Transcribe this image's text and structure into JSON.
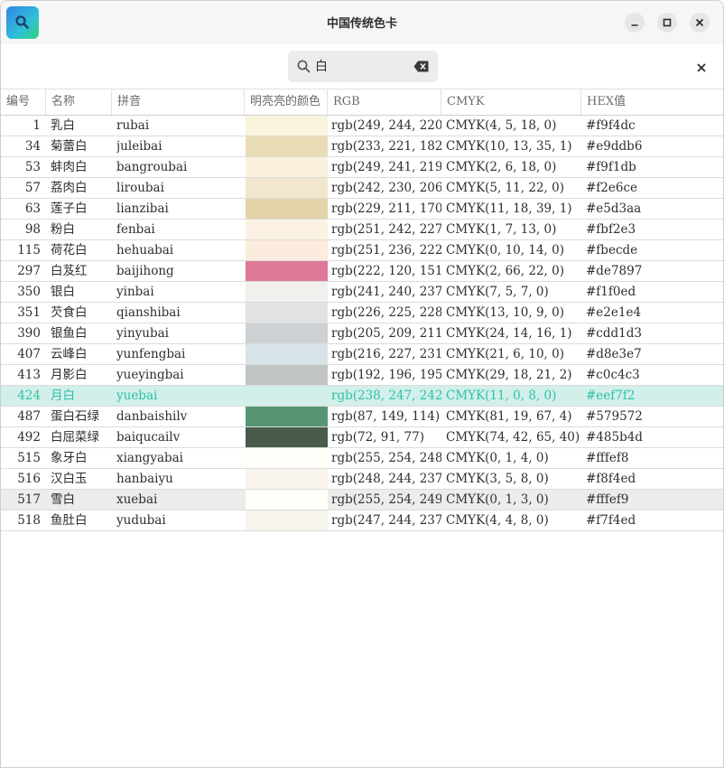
{
  "window": {
    "title": "中国传统色卡"
  },
  "search": {
    "value": "白"
  },
  "columns": [
    "编号",
    "名称",
    "拼音",
    "明亮亮的颜色",
    "RGB",
    "CMYK",
    "HEX值"
  ],
  "rows": [
    {
      "num": "1",
      "name": "乳白",
      "pinyin": "rubai",
      "color": "#f9f4dc",
      "rgb": "rgb(249, 244, 220)",
      "cmyk": "CMYK(4, 5, 18, 0)",
      "hex": "#f9f4dc"
    },
    {
      "num": "34",
      "name": "菊蕾白",
      "pinyin": "juleibai",
      "color": "#e9ddb6",
      "rgb": "rgb(233, 221, 182)",
      "cmyk": "CMYK(10, 13, 35, 1)",
      "hex": "#e9ddb6"
    },
    {
      "num": "53",
      "name": "蚌肉白",
      "pinyin": "bangroubai",
      "color": "#f9f1db",
      "rgb": "rgb(249, 241, 219)",
      "cmyk": "CMYK(2, 6, 18, 0)",
      "hex": "#f9f1db"
    },
    {
      "num": "57",
      "name": "荔肉白",
      "pinyin": "liroubai",
      "color": "#f2e6ce",
      "rgb": "rgb(242, 230, 206)",
      "cmyk": "CMYK(5, 11, 22, 0)",
      "hex": "#f2e6ce"
    },
    {
      "num": "63",
      "name": "莲子白",
      "pinyin": "lianzibai",
      "color": "#e5d3aa",
      "rgb": "rgb(229, 211, 170)",
      "cmyk": "CMYK(11, 18, 39, 1)",
      "hex": "#e5d3aa"
    },
    {
      "num": "98",
      "name": "粉白",
      "pinyin": "fenbai",
      "color": "#fbf2e3",
      "rgb": "rgb(251, 242, 227)",
      "cmyk": "CMYK(1, 7, 13, 0)",
      "hex": "#fbf2e3"
    },
    {
      "num": "115",
      "name": "荷花白",
      "pinyin": "hehuabai",
      "color": "#fbecde",
      "rgb": "rgb(251, 236, 222)",
      "cmyk": "CMYK(0, 10, 14, 0)",
      "hex": "#fbecde"
    },
    {
      "num": "297",
      "name": "白芨红",
      "pinyin": "baijihong",
      "color": "#de7897",
      "rgb": "rgb(222, 120, 151)",
      "cmyk": "CMYK(2, 66, 22, 0)",
      "hex": "#de7897"
    },
    {
      "num": "350",
      "name": "银白",
      "pinyin": "yinbai",
      "color": "#f1f0ed",
      "rgb": "rgb(241, 240, 237)",
      "cmyk": "CMYK(7, 5, 7, 0)",
      "hex": "#f1f0ed"
    },
    {
      "num": "351",
      "name": "芡食白",
      "pinyin": "qianshibai",
      "color": "#e2e1e4",
      "rgb": "rgb(226, 225, 228)",
      "cmyk": "CMYK(13, 10, 9, 0)",
      "hex": "#e2e1e4"
    },
    {
      "num": "390",
      "name": "银鱼白",
      "pinyin": "yinyubai",
      "color": "#cdd1d3",
      "rgb": "rgb(205, 209, 211)",
      "cmyk": "CMYK(24, 14, 16, 1)",
      "hex": "#cdd1d3"
    },
    {
      "num": "407",
      "name": "云峰白",
      "pinyin": "yunfengbai",
      "color": "#d8e3e7",
      "rgb": "rgb(216, 227, 231)",
      "cmyk": "CMYK(21, 6, 10, 0)",
      "hex": "#d8e3e7"
    },
    {
      "num": "413",
      "name": "月影白",
      "pinyin": "yueyingbai",
      "color": "#c0c4c3",
      "rgb": "rgb(192, 196, 195)",
      "cmyk": "CMYK(29, 18, 21, 2)",
      "hex": "#c0c4c3"
    },
    {
      "num": "424",
      "name": "月白",
      "pinyin": "yuebai",
      "color": "#eef7f2",
      "rgb": "rgb(238, 247, 242)",
      "cmyk": "CMYK(11, 0, 8, 0)",
      "hex": "#eef7f2",
      "selected": true
    },
    {
      "num": "487",
      "name": "蛋白石绿",
      "pinyin": "danbaishilv",
      "color": "#579572",
      "rgb": "rgb(87, 149, 114)",
      "cmyk": "CMYK(81, 19, 67, 4)",
      "hex": "#579572"
    },
    {
      "num": "492",
      "name": "白屈菜绿",
      "pinyin": "baiqucailv",
      "color": "#485b4d",
      "rgb": "rgb(72, 91, 77)",
      "cmyk": "CMYK(74, 42, 65, 40)",
      "hex": "#485b4d"
    },
    {
      "num": "515",
      "name": "象牙白",
      "pinyin": "xiangyabai",
      "color": "#fffef8",
      "rgb": "rgb(255, 254, 248)",
      "cmyk": "CMYK(0, 1, 4, 0)",
      "hex": "#fffef8"
    },
    {
      "num": "516",
      "name": "汉白玉",
      "pinyin": "hanbaiyu",
      "color": "#f8f4ed",
      "rgb": "rgb(248, 244, 237)",
      "cmyk": "CMYK(3, 5, 8, 0)",
      "hex": "#f8f4ed"
    },
    {
      "num": "517",
      "name": "雪白",
      "pinyin": "xuebai",
      "color": "#fffef9",
      "rgb": "rgb(255, 254, 249)",
      "cmyk": "CMYK(0, 1, 3, 0)",
      "hex": "#fffef9",
      "hovered": true
    },
    {
      "num": "518",
      "name": "鱼肚白",
      "pinyin": "yudubai",
      "color": "#f7f4ed",
      "rgb": "rgb(247, 244, 237)",
      "cmyk": "CMYK(4, 4, 8, 0)",
      "hex": "#f7f4ed"
    }
  ]
}
